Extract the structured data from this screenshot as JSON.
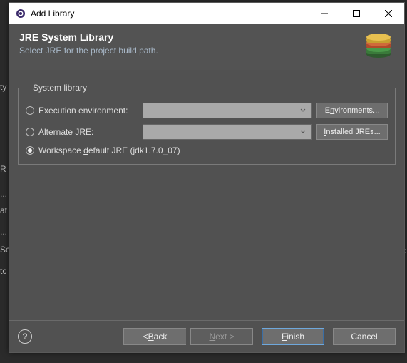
{
  "window": {
    "title": "Add Library"
  },
  "banner": {
    "title": "JRE System Library",
    "subtitle": "Select JRE for the project build path."
  },
  "group": {
    "legend": "System library",
    "options": {
      "exec_env": {
        "label_pre": "E",
        "label_post": "xecution environment:",
        "selected": false,
        "combo_value": "",
        "button_pre": "E",
        "button_mid": "n",
        "button_post": "vironments..."
      },
      "alt_jre": {
        "label_pre": "Alternate ",
        "label_u": "J",
        "label_post": "RE:",
        "selected": false,
        "combo_value": "",
        "button_pre": "",
        "button_u": "I",
        "button_post": "nstalled JREs..."
      },
      "workspace": {
        "label_pre": "Workspace ",
        "label_u": "d",
        "label_post": "efault JRE (jdk1.7.0_07)",
        "selected": true
      }
    }
  },
  "footer": {
    "back_pre": "< ",
    "back_u": "B",
    "back_post": "ack",
    "next_pre": "",
    "next_u": "N",
    "next_post": "ext >",
    "finish_pre": "",
    "finish_u": "F",
    "finish_post": "inish",
    "cancel": "Cancel"
  }
}
